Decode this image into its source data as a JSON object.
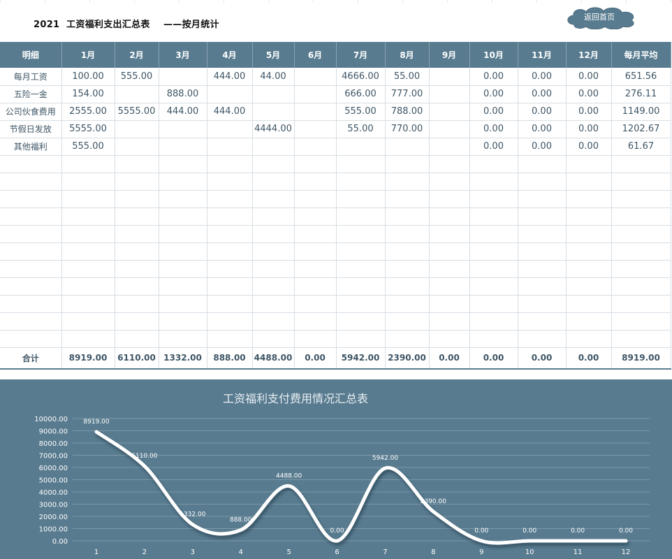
{
  "header": {
    "title": "2021  工资福利支出汇总表    ——按月统计",
    "back_button": "返回首页"
  },
  "table": {
    "columns": [
      "明细",
      "1月",
      "2月",
      "3月",
      "4月",
      "5月",
      "6月",
      "7月",
      "8月",
      "9月",
      "10月",
      "11月",
      "12月",
      "每月平均"
    ],
    "rows": [
      [
        "每月工资",
        "100.00",
        "555.00",
        "",
        "444.00",
        "44.00",
        "",
        "4666.00",
        "55.00",
        "",
        "0.00",
        "0.00",
        "0.00",
        "651.56"
      ],
      [
        "五险一金",
        "154.00",
        "",
        "888.00",
        "",
        "",
        "",
        "666.00",
        "777.00",
        "",
        "0.00",
        "0.00",
        "0.00",
        "276.11"
      ],
      [
        "公司伙食费用",
        "2555.00",
        "5555.00",
        "444.00",
        "444.00",
        "",
        "",
        "555.00",
        "788.00",
        "",
        "0.00",
        "0.00",
        "0.00",
        "1149.00"
      ],
      [
        "节假日发放",
        "5555.00",
        "",
        "",
        "",
        "4444.00",
        "",
        "55.00",
        "770.00",
        "",
        "0.00",
        "0.00",
        "0.00",
        "1202.67"
      ],
      [
        "其他福利",
        "555.00",
        "",
        "",
        "",
        "",
        "",
        "",
        "",
        "",
        "0.00",
        "0.00",
        "0.00",
        "61.67"
      ],
      [
        "",
        "",
        "",
        "",
        "",
        "",
        "",
        "",
        "",
        "",
        "",
        "",
        "",
        ""
      ],
      [
        "",
        "",
        "",
        "",
        "",
        "",
        "",
        "",
        "",
        "",
        "",
        "",
        "",
        ""
      ],
      [
        "",
        "",
        "",
        "",
        "",
        "",
        "",
        "",
        "",
        "",
        "",
        "",
        "",
        ""
      ],
      [
        "",
        "",
        "",
        "",
        "",
        "",
        "",
        "",
        "",
        "",
        "",
        "",
        "",
        ""
      ],
      [
        "",
        "",
        "",
        "",
        "",
        "",
        "",
        "",
        "",
        "",
        "",
        "",
        "",
        ""
      ],
      [
        "",
        "",
        "",
        "",
        "",
        "",
        "",
        "",
        "",
        "",
        "",
        "",
        "",
        ""
      ],
      [
        "",
        "",
        "",
        "",
        "",
        "",
        "",
        "",
        "",
        "",
        "",
        "",
        "",
        ""
      ],
      [
        "",
        "",
        "",
        "",
        "",
        "",
        "",
        "",
        "",
        "",
        "",
        "",
        "",
        ""
      ],
      [
        "",
        "",
        "",
        "",
        "",
        "",
        "",
        "",
        "",
        "",
        "",
        "",
        "",
        ""
      ],
      [
        "",
        "",
        "",
        "",
        "",
        "",
        "",
        "",
        "",
        "",
        "",
        "",
        "",
        ""
      ],
      [
        "",
        "",
        "",
        "",
        "",
        "",
        "",
        "",
        "",
        "",
        "",
        "",
        "",
        ""
      ]
    ],
    "total": [
      "合计",
      "8919.00",
      "6110.00",
      "1332.00",
      "888.00",
      "4488.00",
      "0.00",
      "5942.00",
      "2390.00",
      "0.00",
      "0.00",
      "0.00",
      "0.00",
      "8919.00"
    ]
  },
  "colors": {
    "header_bg": "#587b8f",
    "chart_bg": "#587b8f",
    "line": "#ffffff",
    "text": "#3e5565"
  },
  "chart_data": {
    "type": "line",
    "title": "工资福利支付费用情况汇总表",
    "x": [
      "1",
      "2",
      "3",
      "4",
      "5",
      "6",
      "7",
      "8",
      "9",
      "10",
      "11",
      "12"
    ],
    "values": [
      8919,
      6110,
      1332,
      888,
      4488,
      0,
      5942,
      2390,
      0,
      0,
      0,
      0
    ],
    "data_labels": [
      "8919.00",
      "6110.00",
      "1332.00",
      "888.00",
      "4488.00",
      "0.00",
      "5942.00",
      "2390.00",
      "0.00",
      "0.00",
      "0.00",
      "0.00"
    ],
    "y_ticks": [
      "0.00",
      "1000.00",
      "2000.00",
      "3000.00",
      "4000.00",
      "5000.00",
      "6000.00",
      "7000.00",
      "8000.00",
      "9000.00",
      "10000.00"
    ],
    "ylim": [
      0,
      10000
    ],
    "grid": true,
    "smooth": true,
    "legend": "none"
  }
}
